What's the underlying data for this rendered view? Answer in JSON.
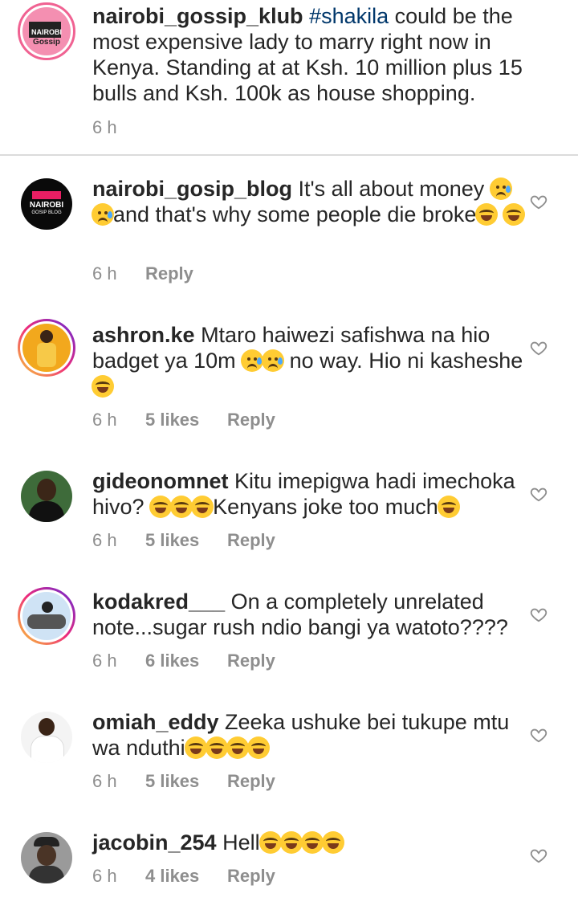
{
  "caption": {
    "username": "nairobi_gossip_klub",
    "hashtag": "#shakila",
    "text": " could be the most expensive lady to marry right now in Kenya. Standing at at Ksh. 10 million plus 15 bulls and Ksh. 100k as house shopping.",
    "time": "6 h",
    "avatar_text_top": "NAIROBI",
    "avatar_text_bottom": "Gossip"
  },
  "comments": [
    {
      "username": "nairobi_gosip_blog",
      "text_a": " It's all about money ",
      "text_b": "and that's why some people die broke",
      "time": "6 h",
      "likes": "",
      "reply": "Reply",
      "avatar_text_top": "NAIROBI",
      "avatar_text_bottom": "GOSIP BLOG"
    },
    {
      "username": "ashron.ke",
      "text_a": " Mtaro haiwezi safishwa na hio badget ya 10m ",
      "text_b": " no way. Hio ni kasheshe",
      "time": "6 h",
      "likes": "5 likes",
      "reply": "Reply"
    },
    {
      "username": "gideonomnet",
      "text_a": " Kitu imepigwa hadi imechoka hivo? ",
      "text_b": "Kenyans joke too much",
      "time": "6 h",
      "likes": "5 likes",
      "reply": "Reply"
    },
    {
      "username": "kodakred___",
      "text_a": " On a completely unrelated note...sugar rush ndio bangi ya watoto????",
      "text_b": "",
      "time": "6 h",
      "likes": "6 likes",
      "reply": "Reply"
    },
    {
      "username": "omiah_eddy",
      "text_a": " Zeeka ushuke bei tukupe mtu wa nduthi",
      "text_b": "",
      "time": "6 h",
      "likes": "5 likes",
      "reply": "Reply"
    },
    {
      "username": "jacobin_254",
      "text_a": " Hell",
      "text_b": "",
      "time": "6 h",
      "likes": "4 likes",
      "reply": "Reply"
    }
  ],
  "icons": {
    "like": "heart-outline-icon",
    "emoji_laugh": "tears-of-joy-emoji",
    "emoji_cry": "crying-face-emoji"
  },
  "colors": {
    "hashtag": "#00376b",
    "meta": "#8e8e8e",
    "divider": "#dbdbdb"
  }
}
